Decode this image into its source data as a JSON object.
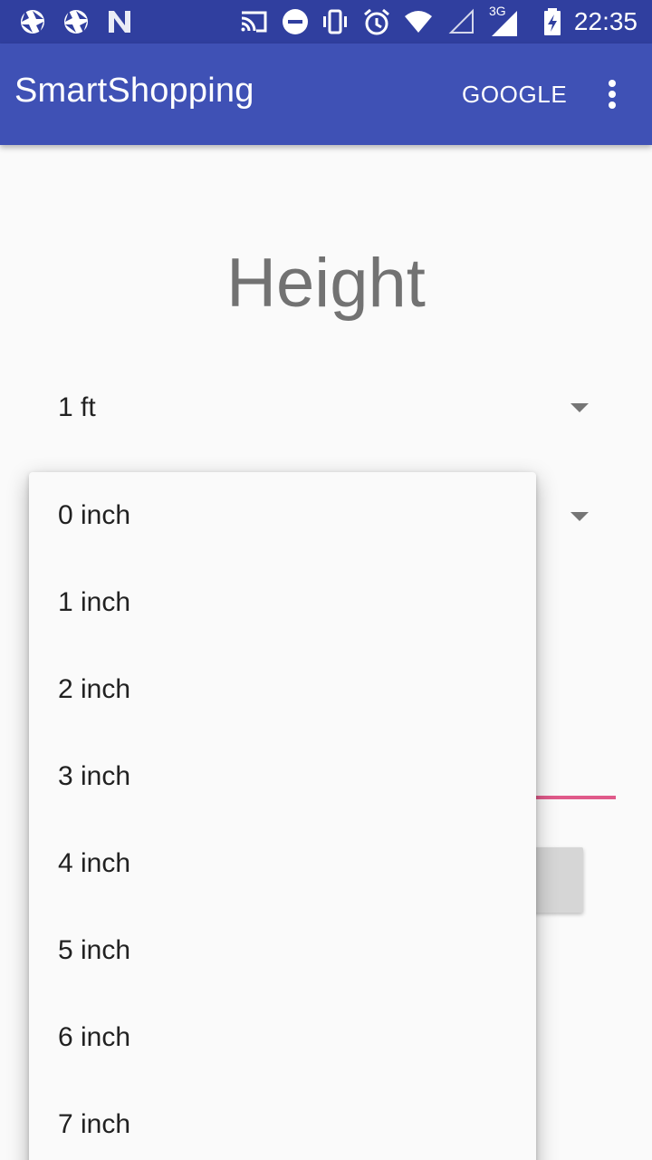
{
  "status_bar": {
    "time": "22:35",
    "network_type": "3G",
    "icons": [
      "shutter-icon",
      "shutter-icon",
      "n-icon",
      "cast-icon",
      "do-not-disturb-icon",
      "vibrate-icon",
      "alarm-icon",
      "wifi-icon",
      "signal-empty-icon",
      "signal-3g-icon",
      "battery-charging-icon"
    ]
  },
  "app_bar": {
    "title": "SmartShopping",
    "action_label": "GOOGLE"
  },
  "main": {
    "heading": "Height",
    "feet_spinner_value": "1 ft",
    "background_button_partial": "v"
  },
  "dropdown": {
    "options": [
      "0 inch",
      "1 inch",
      "2 inch",
      "3 inch",
      "4 inch",
      "5 inch",
      "6 inch",
      "7 inch"
    ]
  },
  "colors": {
    "status_bar": "#303f9f",
    "app_bar": "#3f51b5",
    "accent": "#e05a8a"
  }
}
